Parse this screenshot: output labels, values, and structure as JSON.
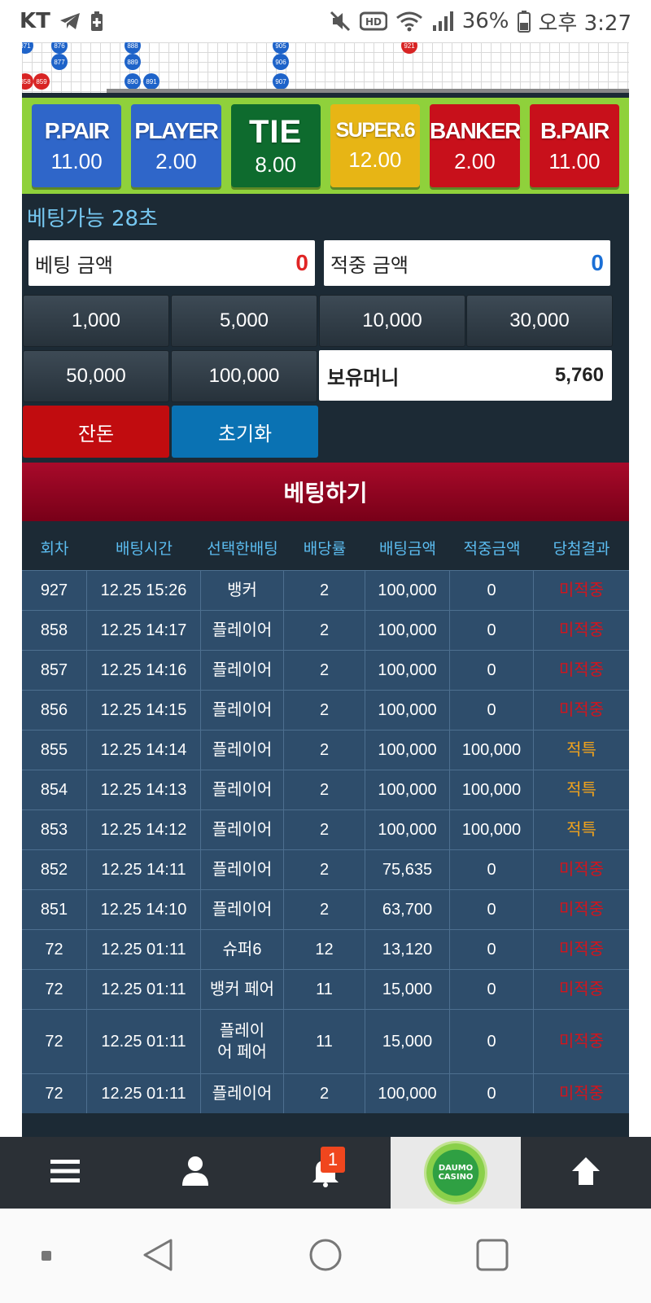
{
  "status_bar": {
    "carrier": "KT",
    "battery": "36%",
    "time": "오후 3:27"
  },
  "roadmap": {
    "dots": [
      {
        "label": "871",
        "color": "blue"
      },
      {
        "label": "876",
        "color": "blue"
      },
      {
        "label": "877",
        "color": "blue"
      },
      {
        "label": "858",
        "color": "red"
      },
      {
        "label": "859",
        "color": "red"
      },
      {
        "label": "888",
        "color": "blue"
      },
      {
        "label": "889",
        "color": "blue"
      },
      {
        "label": "890",
        "color": "blue"
      },
      {
        "label": "891",
        "color": "blue"
      },
      {
        "label": "905",
        "color": "blue"
      },
      {
        "label": "906",
        "color": "blue"
      },
      {
        "label": "907",
        "color": "blue"
      },
      {
        "label": "921",
        "color": "red"
      }
    ]
  },
  "bets": [
    {
      "label": "P.PAIR",
      "odds": "11.00",
      "color": "#2f66c9"
    },
    {
      "label": "PLAYER",
      "odds": "2.00",
      "color": "#2f66c9"
    },
    {
      "label": "TIE",
      "odds": "8.00",
      "color": "#0e6b2e"
    },
    {
      "label": "SUPER.6",
      "odds": "12.00",
      "color": "#e7b515"
    },
    {
      "label": "BANKER",
      "odds": "2.00",
      "color": "#c8101b"
    },
    {
      "label": "B.PAIR",
      "odds": "11.00",
      "color": "#c8101b"
    }
  ],
  "betting_available": "베팅가능 28초",
  "bet_amount": {
    "label": "베팅 금액",
    "value": "0"
  },
  "win_amount": {
    "label": "적중 금액",
    "value": "0"
  },
  "chips": [
    "1,000",
    "5,000",
    "10,000",
    "30,000",
    "50,000",
    "100,000"
  ],
  "money": {
    "label": "보유머니",
    "value": "5,760"
  },
  "change_button": "잔돈",
  "reset_button": "초기화",
  "place_bet_button": "베팅하기",
  "history": {
    "headers": [
      "회차",
      "배팅시간",
      "선택한배팅",
      "배당률",
      "배팅금액",
      "적중금액",
      "당첨결과"
    ],
    "rows": [
      [
        "927",
        "12.25 15:26",
        "뱅커",
        "2",
        "100,000",
        "0",
        "미적중"
      ],
      [
        "858",
        "12.25 14:17",
        "플레이어",
        "2",
        "100,000",
        "0",
        "미적중"
      ],
      [
        "857",
        "12.25 14:16",
        "플레이어",
        "2",
        "100,000",
        "0",
        "미적중"
      ],
      [
        "856",
        "12.25 14:15",
        "플레이어",
        "2",
        "100,000",
        "0",
        "미적중"
      ],
      [
        "855",
        "12.25 14:14",
        "플레이어",
        "2",
        "100,000",
        "100,000",
        "적특"
      ],
      [
        "854",
        "12.25 14:13",
        "플레이어",
        "2",
        "100,000",
        "100,000",
        "적특"
      ],
      [
        "853",
        "12.25 14:12",
        "플레이어",
        "2",
        "100,000",
        "100,000",
        "적특"
      ],
      [
        "852",
        "12.25 14:11",
        "플레이어",
        "2",
        "75,635",
        "0",
        "미적중"
      ],
      [
        "851",
        "12.25 14:10",
        "플레이어",
        "2",
        "63,700",
        "0",
        "미적중"
      ],
      [
        "72",
        "12.25 01:11",
        "슈퍼6",
        "12",
        "13,120",
        "0",
        "미적중"
      ],
      [
        "72",
        "12.25 01:11",
        "뱅커 페어",
        "11",
        "15,000",
        "0",
        "미적중"
      ],
      [
        "72",
        "12.25 01:11",
        "플레이어 페어",
        "11",
        "15,000",
        "0",
        "미적중"
      ],
      [
        "72",
        "12.25 01:11",
        "플레이어",
        "2",
        "100,000",
        "0",
        "미적중"
      ]
    ]
  },
  "bottom_nav": {
    "notification_count": "1",
    "logo_text": "DAUMO CASINO"
  },
  "colors": {
    "accent_blue": "#5bbcf0",
    "lose_red": "#d4141c",
    "win_orange": "#f0a21c",
    "bet_red": "#e02525",
    "win_blue": "#1a6fd6"
  }
}
